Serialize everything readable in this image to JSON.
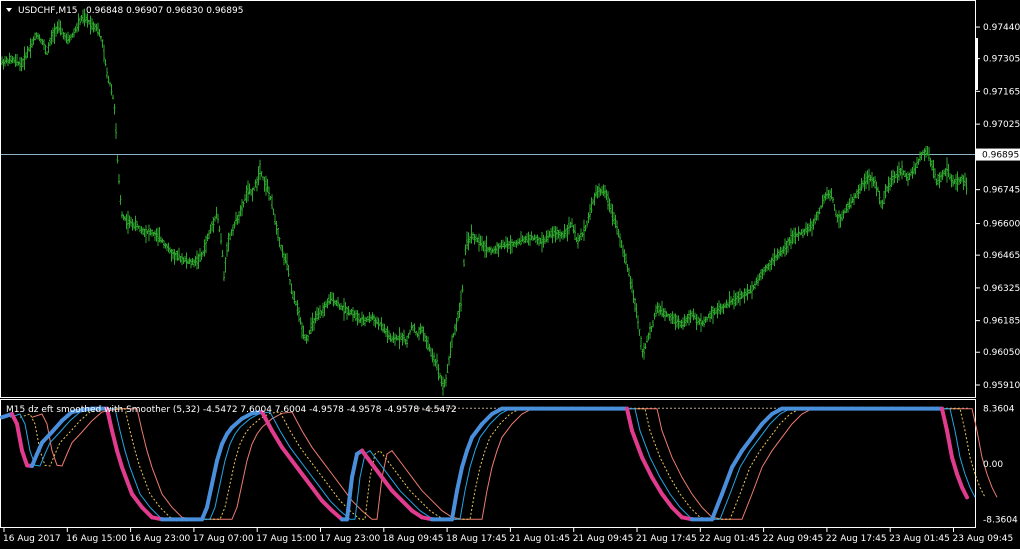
{
  "colors": {
    "background": "#000000",
    "frame": "#ffffff",
    "candles": "#2ea52e",
    "bid_line": "#8fb2c6",
    "osc_up": "#4a8fdc",
    "osc_down": "#e13b8e",
    "osc_fast": "#22a6e6",
    "osc_dotted": "#e8c85a",
    "osc_slow": "#ef7b70",
    "osc_ref": "#b7a58a",
    "current_price_box": "#ffffff"
  },
  "header": {
    "symbol": "USDCHF,M15",
    "ohlc": "0.96848 0.96907 0.96830 0.96895",
    "menu_icon": "triangle-down-icon"
  },
  "indicator": {
    "label": "M15 dz eft smoothed with Smoother (5,32) -4.5472 7.6004 7.6004 -4.9578 -4.9578 -4.9578 -4.5472"
  },
  "current_price": "0.96895",
  "chart_data": [
    {
      "type": "line",
      "name_shown": "USDCHF,M15",
      "yticks": [
        "0.97440",
        "0.97305",
        "0.97165",
        "0.97025",
        "0.96745",
        "0.96600",
        "0.96465",
        "0.96325",
        "0.96185",
        "0.96050",
        "0.95910"
      ],
      "ylim": [
        0.9588,
        0.9753
      ],
      "x": [
        0,
        10,
        20,
        25,
        30,
        35,
        40,
        45,
        50,
        55,
        60,
        65,
        70,
        75,
        80,
        85,
        90,
        95,
        100,
        105,
        110,
        113,
        115,
        118,
        120,
        125,
        130,
        135,
        140,
        150,
        160,
        170,
        180,
        190,
        200,
        205,
        210,
        215,
        220,
        222,
        225,
        230,
        235,
        240,
        245,
        250,
        255,
        258,
        262,
        266,
        270,
        275,
        280,
        285,
        290,
        295,
        300,
        305,
        310,
        315,
        320,
        325,
        330,
        340,
        350,
        360,
        370,
        380,
        390,
        400,
        405,
        410,
        415,
        420,
        425,
        430,
        435,
        438,
        441,
        444,
        447,
        450,
        455,
        460,
        462,
        465,
        470,
        480,
        490,
        500,
        510,
        520,
        530,
        540,
        550,
        560,
        570,
        575,
        580,
        585,
        590,
        595,
        600,
        605,
        610,
        615,
        620,
        625,
        630,
        635,
        638,
        641,
        645,
        650,
        655,
        660,
        665,
        670,
        680,
        690,
        700,
        710,
        720,
        730,
        740,
        750,
        760,
        770,
        780,
        790,
        800,
        810,
        815,
        820,
        825,
        830,
        835,
        840,
        845,
        850,
        855,
        860,
        865,
        870,
        875,
        880,
        885,
        890,
        895,
        900,
        905,
        910,
        915,
        920,
        925,
        930,
        935,
        940,
        945,
        950,
        955,
        960,
        965
      ],
      "values": [
        0.9729,
        0.973,
        0.9728,
        0.9733,
        0.9737,
        0.9741,
        0.9738,
        0.9733,
        0.974,
        0.9744,
        0.9742,
        0.9738,
        0.974,
        0.9744,
        0.9748,
        0.9747,
        0.9745,
        0.9744,
        0.9738,
        0.9724,
        0.9717,
        0.9708,
        0.969,
        0.9672,
        0.9664,
        0.9661,
        0.966,
        0.9659,
        0.9657,
        0.9656,
        0.9653,
        0.9647,
        0.9645,
        0.9643,
        0.9646,
        0.9653,
        0.9659,
        0.9665,
        0.965,
        0.9637,
        0.965,
        0.9657,
        0.9662,
        0.9666,
        0.9674,
        0.9673,
        0.9678,
        0.9684,
        0.9678,
        0.9675,
        0.9668,
        0.9658,
        0.9648,
        0.9643,
        0.963,
        0.9625,
        0.9615,
        0.961,
        0.9617,
        0.962,
        0.9622,
        0.9626,
        0.9628,
        0.9624,
        0.9622,
        0.9618,
        0.962,
        0.9616,
        0.961,
        0.9612,
        0.9609,
        0.9617,
        0.9612,
        0.9615,
        0.9609,
        0.9604,
        0.96,
        0.9595,
        0.9591,
        0.9593,
        0.9602,
        0.961,
        0.9618,
        0.9629,
        0.9643,
        0.9652,
        0.9655,
        0.9651,
        0.9648,
        0.9651,
        0.9651,
        0.9653,
        0.9654,
        0.9652,
        0.9656,
        0.9655,
        0.966,
        0.9652,
        0.9655,
        0.966,
        0.9668,
        0.9674,
        0.9674,
        0.9672,
        0.9665,
        0.9659,
        0.965,
        0.9642,
        0.9633,
        0.9621,
        0.9612,
        0.9604,
        0.961,
        0.9616,
        0.9624,
        0.9622,
        0.9621,
        0.962,
        0.9617,
        0.9621,
        0.9617,
        0.9622,
        0.9624,
        0.9627,
        0.9629,
        0.9632,
        0.9639,
        0.9644,
        0.9648,
        0.9654,
        0.9656,
        0.9659,
        0.9663,
        0.9668,
        0.9673,
        0.9672,
        0.9662,
        0.9663,
        0.9667,
        0.9669,
        0.9673,
        0.9677,
        0.9679,
        0.9679,
        0.9676,
        0.9667,
        0.9675,
        0.9679,
        0.9681,
        0.9683,
        0.9679,
        0.9682,
        0.9685,
        0.969,
        0.9691,
        0.9685,
        0.9677,
        0.9681,
        0.9683,
        0.9678,
        0.9677,
        0.968,
        0.9676,
        0.9682,
        0.969
      ]
    },
    {
      "type": "line",
      "name_shown": "M15 dz eft smoothed with Smoother (5,32)",
      "yticks": [
        "8.3604",
        "0.00",
        "-8.3604"
      ],
      "ylim": [
        -9.0,
        9.0
      ],
      "x": [
        0,
        10,
        15,
        20,
        25,
        30,
        35,
        40,
        50,
        60,
        70,
        80,
        90,
        100,
        105,
        110,
        115,
        120,
        125,
        130,
        140,
        150,
        160,
        170,
        175,
        180,
        185,
        190,
        200,
        205,
        210,
        215,
        220,
        225,
        230,
        240,
        250,
        260,
        270,
        280,
        290,
        300,
        310,
        320,
        330,
        340,
        345,
        350,
        355,
        360,
        370,
        380,
        390,
        400,
        410,
        420,
        430,
        440,
        450,
        455,
        460,
        465,
        470,
        480,
        490,
        500,
        510,
        520,
        530,
        540,
        550,
        560,
        570,
        580,
        590,
        600,
        610,
        620,
        625,
        630,
        640,
        650,
        660,
        670,
        680,
        690,
        700,
        705,
        710,
        720,
        730,
        740,
        750,
        760,
        770,
        780,
        790,
        800,
        810,
        820,
        830,
        840,
        850,
        860,
        870,
        880,
        890,
        900,
        910,
        920,
        930,
        935,
        940,
        945,
        950,
        955,
        960,
        965
      ],
      "series": [
        {
          "values": [
            7.0,
            7.5,
            6.0,
            2.0,
            -0.2,
            -0.3,
            1.5,
            3.2,
            4.8,
            6.5,
            7.8,
            8.1,
            8.3,
            8.3,
            8.3,
            5.0,
            2.0,
            -0.5,
            -2.5,
            -4.5,
            -6.5,
            -8.0,
            -8.3,
            -8.3,
            -8.3,
            -8.3,
            -8.3,
            -8.3,
            -8.3,
            -6.5,
            -3.0,
            0.5,
            3.0,
            4.5,
            5.5,
            6.8,
            7.6,
            7.8,
            5.0,
            2.5,
            0.5,
            -1.5,
            -3.5,
            -5.5,
            -7.0,
            -8.3,
            -8.3,
            -2.0,
            1.5,
            2.0,
            0.0,
            -2.0,
            -4.0,
            -5.5,
            -7.0,
            -8.0,
            -8.3,
            -8.3,
            -8.3,
            -4.0,
            -0.5,
            2.0,
            4.0,
            6.0,
            7.5,
            8.3,
            8.3,
            8.3,
            8.3,
            8.3,
            8.3,
            8.3,
            8.3,
            8.3,
            8.3,
            8.3,
            8.3,
            8.3,
            8.3,
            5.0,
            1.0,
            -2.0,
            -4.5,
            -6.5,
            -8.0,
            -8.3,
            -8.3,
            -8.3,
            -8.3,
            -4.5,
            -0.5,
            2.0,
            4.0,
            6.0,
            7.5,
            8.3,
            8.3,
            8.3,
            8.3,
            8.3,
            8.3,
            8.3,
            8.3,
            8.3,
            8.3,
            8.3,
            8.3,
            8.3,
            8.3,
            8.3,
            8.3,
            8.3,
            8.3,
            5.0,
            1.0,
            -1.5,
            -3.5,
            -5.0
          ]
        },
        {
          "values": [
            -4.0,
            -4.5,
            -5.5,
            -5.5,
            -5.5,
            -5.5,
            -5.5,
            -5.5,
            -5.5,
            -5.5,
            -5.5,
            -5.5,
            -5.5,
            -5.5,
            -5.5,
            -5.5,
            -5.5,
            -5.5,
            -5.5,
            -5.5,
            -5.5,
            -5.5,
            -5.5,
            -5.5,
            -5.5,
            -5.5,
            -5.5,
            -5.5,
            -5.5,
            -5.5,
            -5.5,
            -5.5,
            -5.5,
            -5.5,
            -5.5,
            -5.5,
            -5.5,
            -8.3,
            -8.3,
            -8.3,
            -8.3,
            -8.3,
            -8.3,
            -8.3,
            -8.3,
            -8.3,
            -8.3,
            -8.3,
            -8.3,
            -8.3,
            -8.3,
            -8.3,
            -8.3,
            -8.3,
            -8.3,
            -8.3,
            -8.3,
            -8.3,
            -8.3,
            -8.3,
            -8.3,
            -8.3,
            -8.3,
            -8.3,
            -8.3,
            -8.3,
            -8.3,
            -8.3,
            -8.3,
            -4.0,
            -1.5,
            0.5,
            2.0,
            3.5,
            5.0,
            6.0,
            6.8,
            7.3,
            7.6,
            7.6,
            7.6,
            7.6,
            7.6,
            7.6,
            7.6,
            7.6,
            7.6,
            7.6,
            7.6,
            7.6,
            7.6,
            7.6,
            7.6,
            7.6,
            7.6,
            7.6,
            7.6,
            7.6,
            7.6,
            7.6,
            7.6,
            7.6,
            7.6,
            7.6,
            7.6,
            7.6,
            7.6,
            7.6,
            7.6,
            7.6,
            7.6,
            7.6,
            7.6,
            7.6,
            7.6,
            7.6,
            7.6,
            7.6
          ]
        }
      ]
    }
  ],
  "time_axis": {
    "labels": [
      "16 Aug 2017",
      "16 Aug 15:00",
      "16 Aug 23:00",
      "17 Aug 07:00",
      "17 Aug 15:00",
      "17 Aug 23:00",
      "18 Aug 09:45",
      "18 Aug 17:45",
      "21 Aug 01:45",
      "21 Aug 09:45",
      "21 Aug 17:45",
      "22 Aug 01:45",
      "22 Aug 09:45",
      "22 Aug 17:45",
      "23 Aug 01:45",
      "23 Aug 09:45"
    ]
  }
}
